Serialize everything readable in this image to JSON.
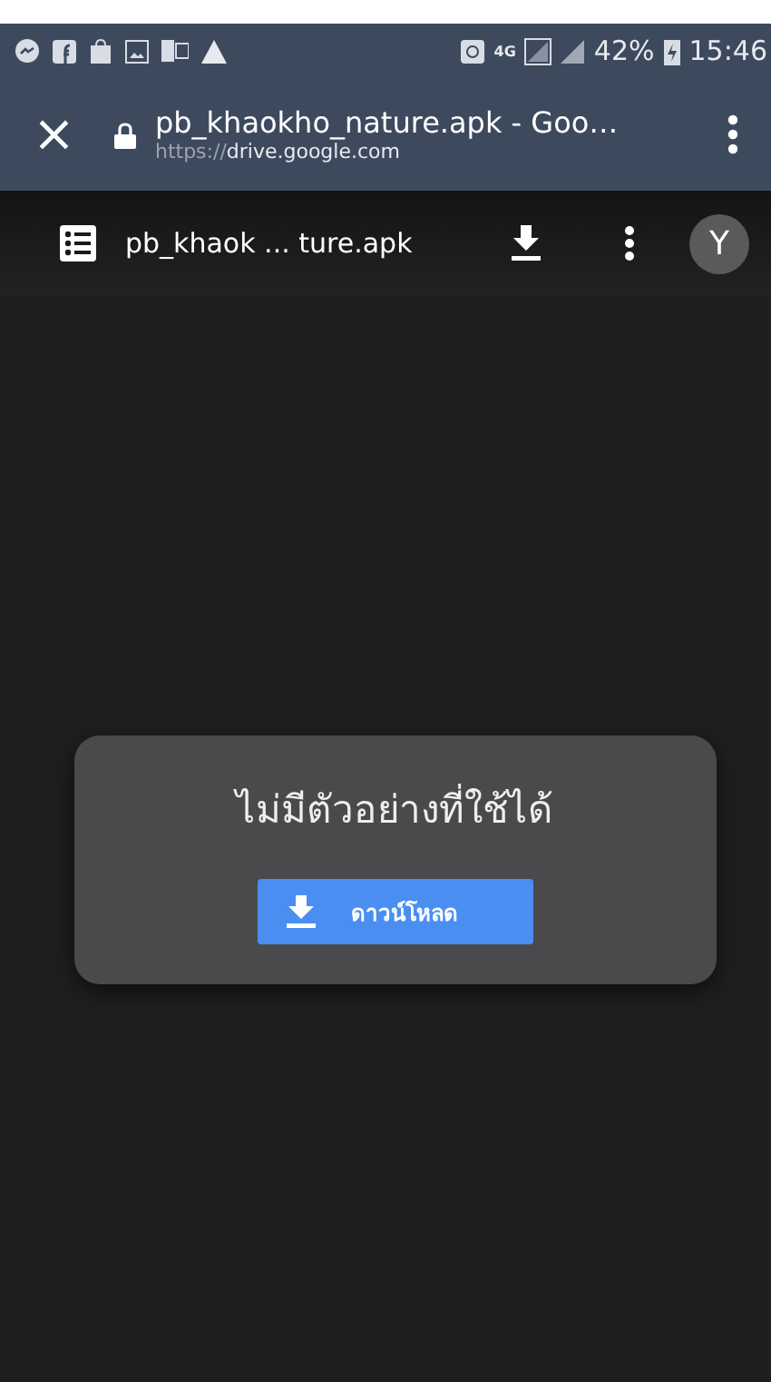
{
  "status_bar": {
    "battery": "42%",
    "time": "15:46",
    "network": "4G"
  },
  "browser_bar": {
    "close": "×",
    "title": "pb_khaokho_nature.apk - Goo…",
    "url_scheme": "https://",
    "url_host": "drive.google.com"
  },
  "viewer_bar": {
    "file_name": "pb_khaok ... ture.apk",
    "avatar": "Y"
  },
  "dialog": {
    "message": "ไม่มีตัวอย่างที่ใช้ได้",
    "button": "ดาวน์โหลด"
  }
}
